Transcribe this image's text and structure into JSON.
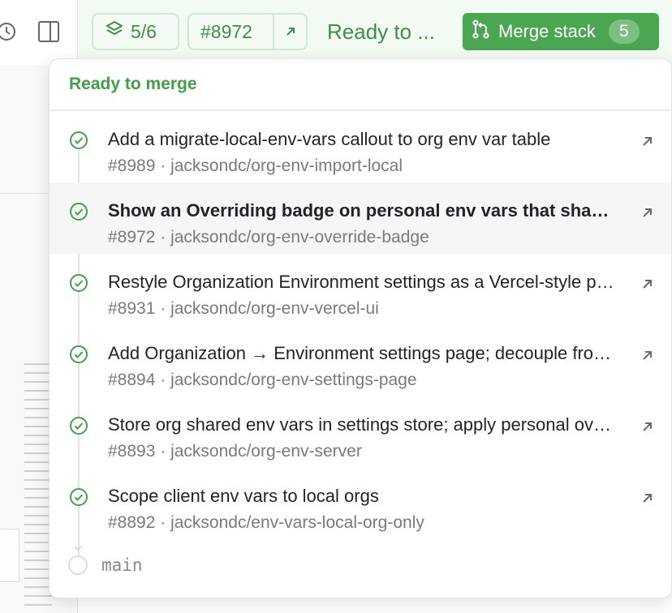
{
  "toolbar": {
    "history_icon": "history-icon",
    "panel_icon": "split-panel-icon"
  },
  "topbar": {
    "stack_position": "5/6",
    "stack_icon": "layers-icon",
    "pr_number": "#8972",
    "open_icon": "external-arrow-icon",
    "status": "Ready to ...",
    "merge_button_label": "Merge stack",
    "merge_count": "5",
    "merge_icon": "git-merge-icon"
  },
  "popover": {
    "header": "Ready to merge",
    "items": [
      {
        "title": "Add a migrate-local-env-vars callout to org env var table",
        "pr": "#8989",
        "branch": "jacksondc/org-env-import-local",
        "active": false
      },
      {
        "title": "Show an Overriding badge on personal env vars that shadow org vars",
        "pr": "#8972",
        "branch": "jacksondc/org-env-override-badge",
        "active": true
      },
      {
        "title": "Restyle Organization Environment settings as a Vercel-style page",
        "pr": "#8931",
        "branch": "jacksondc/org-env-vercel-ui",
        "active": false
      },
      {
        "title": "Add Organization → Environment settings page; decouple from local",
        "pr": "#8894",
        "branch": "jacksondc/org-env-settings-page",
        "active": false
      },
      {
        "title": "Store org shared env vars in settings store; apply personal overrides",
        "pr": "#8893",
        "branch": "jacksondc/org-env-server",
        "active": false
      },
      {
        "title": "Scope client env vars to local orgs",
        "pr": "#8892",
        "branch": "jacksondc/env-vars-local-org-only",
        "active": false
      }
    ],
    "base_branch": "main"
  },
  "colors": {
    "accent_green": "#4ba651",
    "text_green": "#3f8f45",
    "chip_border": "#cfe8cf"
  }
}
